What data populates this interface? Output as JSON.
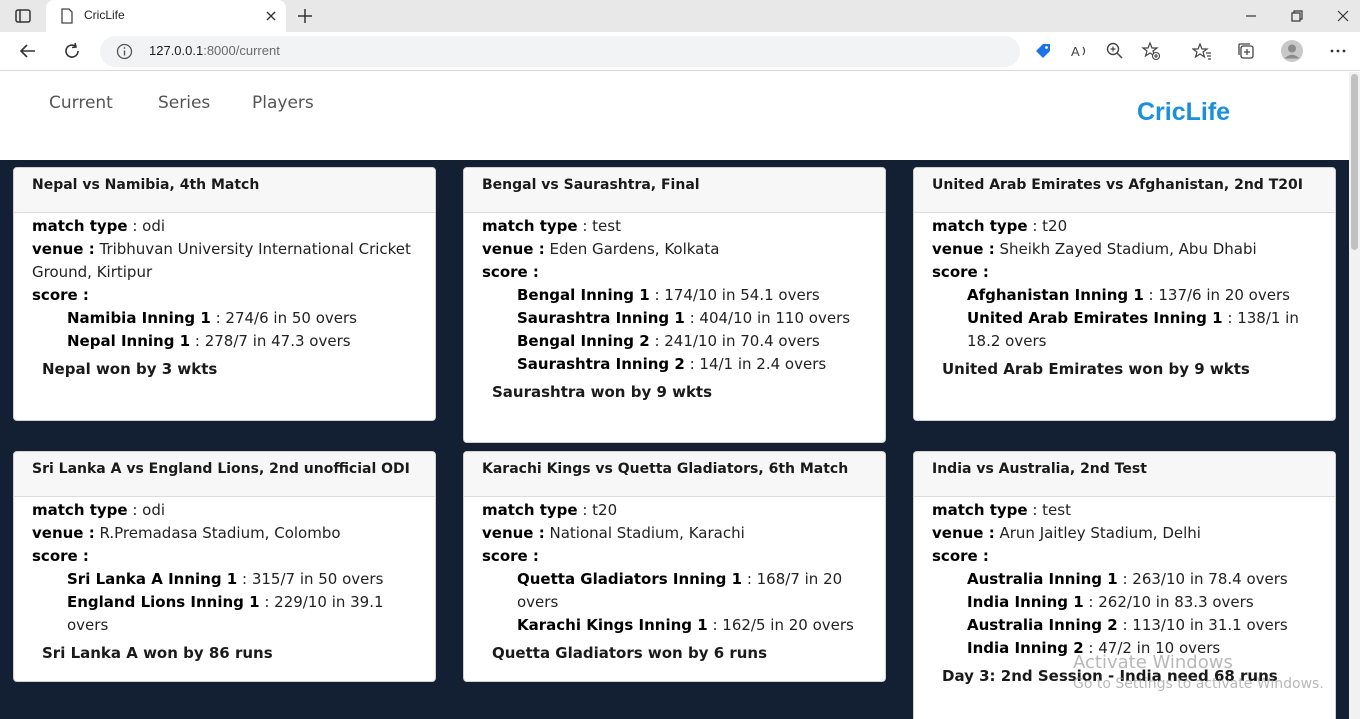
{
  "browser": {
    "tab_title": "CricLife",
    "url_host": "127.0.0.1",
    "url_rest": ":8000/current"
  },
  "site": {
    "brand": "CricLife",
    "nav": [
      "Current",
      "Series",
      "Players"
    ],
    "brand_color": "#1a8fdc",
    "background_color": "#132034"
  },
  "labels": {
    "match_type": "match type",
    "venue": "venue :",
    "score": "score :"
  },
  "matches": [
    {
      "title": "Nepal vs Namibia, 4th Match",
      "type": "odi",
      "venue": "Tribhuvan University International Cricket Ground, Kirtipur",
      "innings": [
        {
          "name": "Namibia Inning 1",
          "score": "274/6 in 50 overs"
        },
        {
          "name": "Nepal Inning 1",
          "score": "278/7 in 47.3 overs"
        }
      ],
      "status": "Nepal won by 3 wkts"
    },
    {
      "title": "Bengal vs Saurashtra, Final",
      "type": "test",
      "venue": "Eden Gardens, Kolkata",
      "innings": [
        {
          "name": "Bengal Inning 1",
          "score": "174/10 in 54.1 overs"
        },
        {
          "name": "Saurashtra Inning 1",
          "score": "404/10 in 110 overs"
        },
        {
          "name": "Bengal Inning 2",
          "score": "241/10 in 70.4 overs"
        },
        {
          "name": "Saurashtra Inning 2",
          "score": "14/1 in 2.4 overs"
        }
      ],
      "status": "Saurashtra won by 9 wkts"
    },
    {
      "title": "United Arab Emirates vs Afghanistan, 2nd T20I",
      "type": "t20",
      "venue": "Sheikh Zayed Stadium, Abu Dhabi",
      "innings": [
        {
          "name": "Afghanistan Inning 1",
          "score": "137/6 in 20 overs"
        },
        {
          "name": "United Arab Emirates Inning 1",
          "score": "138/1 in 18.2 overs"
        }
      ],
      "status": "United Arab Emirates won by 9 wkts"
    },
    {
      "title": "Sri Lanka A vs England Lions, 2nd unofficial ODI",
      "type": "odi",
      "venue": "R.Premadasa Stadium, Colombo",
      "innings": [
        {
          "name": "Sri Lanka A Inning 1",
          "score": "315/7 in 50 overs"
        },
        {
          "name": "England Lions Inning 1",
          "score": "229/10 in 39.1 overs"
        }
      ],
      "status": "Sri Lanka A won by 86 runs"
    },
    {
      "title": "Karachi Kings vs Quetta Gladiators, 6th Match",
      "type": "t20",
      "venue": "National Stadium, Karachi",
      "innings": [
        {
          "name": "Quetta Gladiators Inning 1",
          "score": "168/7 in 20 overs"
        },
        {
          "name": "Karachi Kings Inning 1",
          "score": "162/5 in 20 overs"
        }
      ],
      "status": "Quetta Gladiators won by 6 runs"
    },
    {
      "title": "India vs Australia, 2nd Test",
      "type": "test",
      "venue": "Arun Jaitley Stadium, Delhi",
      "innings": [
        {
          "name": "Australia Inning 1",
          "score": "263/10 in 78.4 overs"
        },
        {
          "name": "India Inning 1",
          "score": "262/10 in 83.3 overs"
        },
        {
          "name": "Australia Inning 2",
          "score": "113/10 in 31.1 overs"
        },
        {
          "name": "India Inning 2",
          "score": "47/2 in 10 overs"
        }
      ],
      "status": "Day 3: 2nd Session - India need 68 runs"
    }
  ],
  "watermark": {
    "line1": "Activate Windows",
    "line2": "Go to Settings to activate Windows."
  }
}
